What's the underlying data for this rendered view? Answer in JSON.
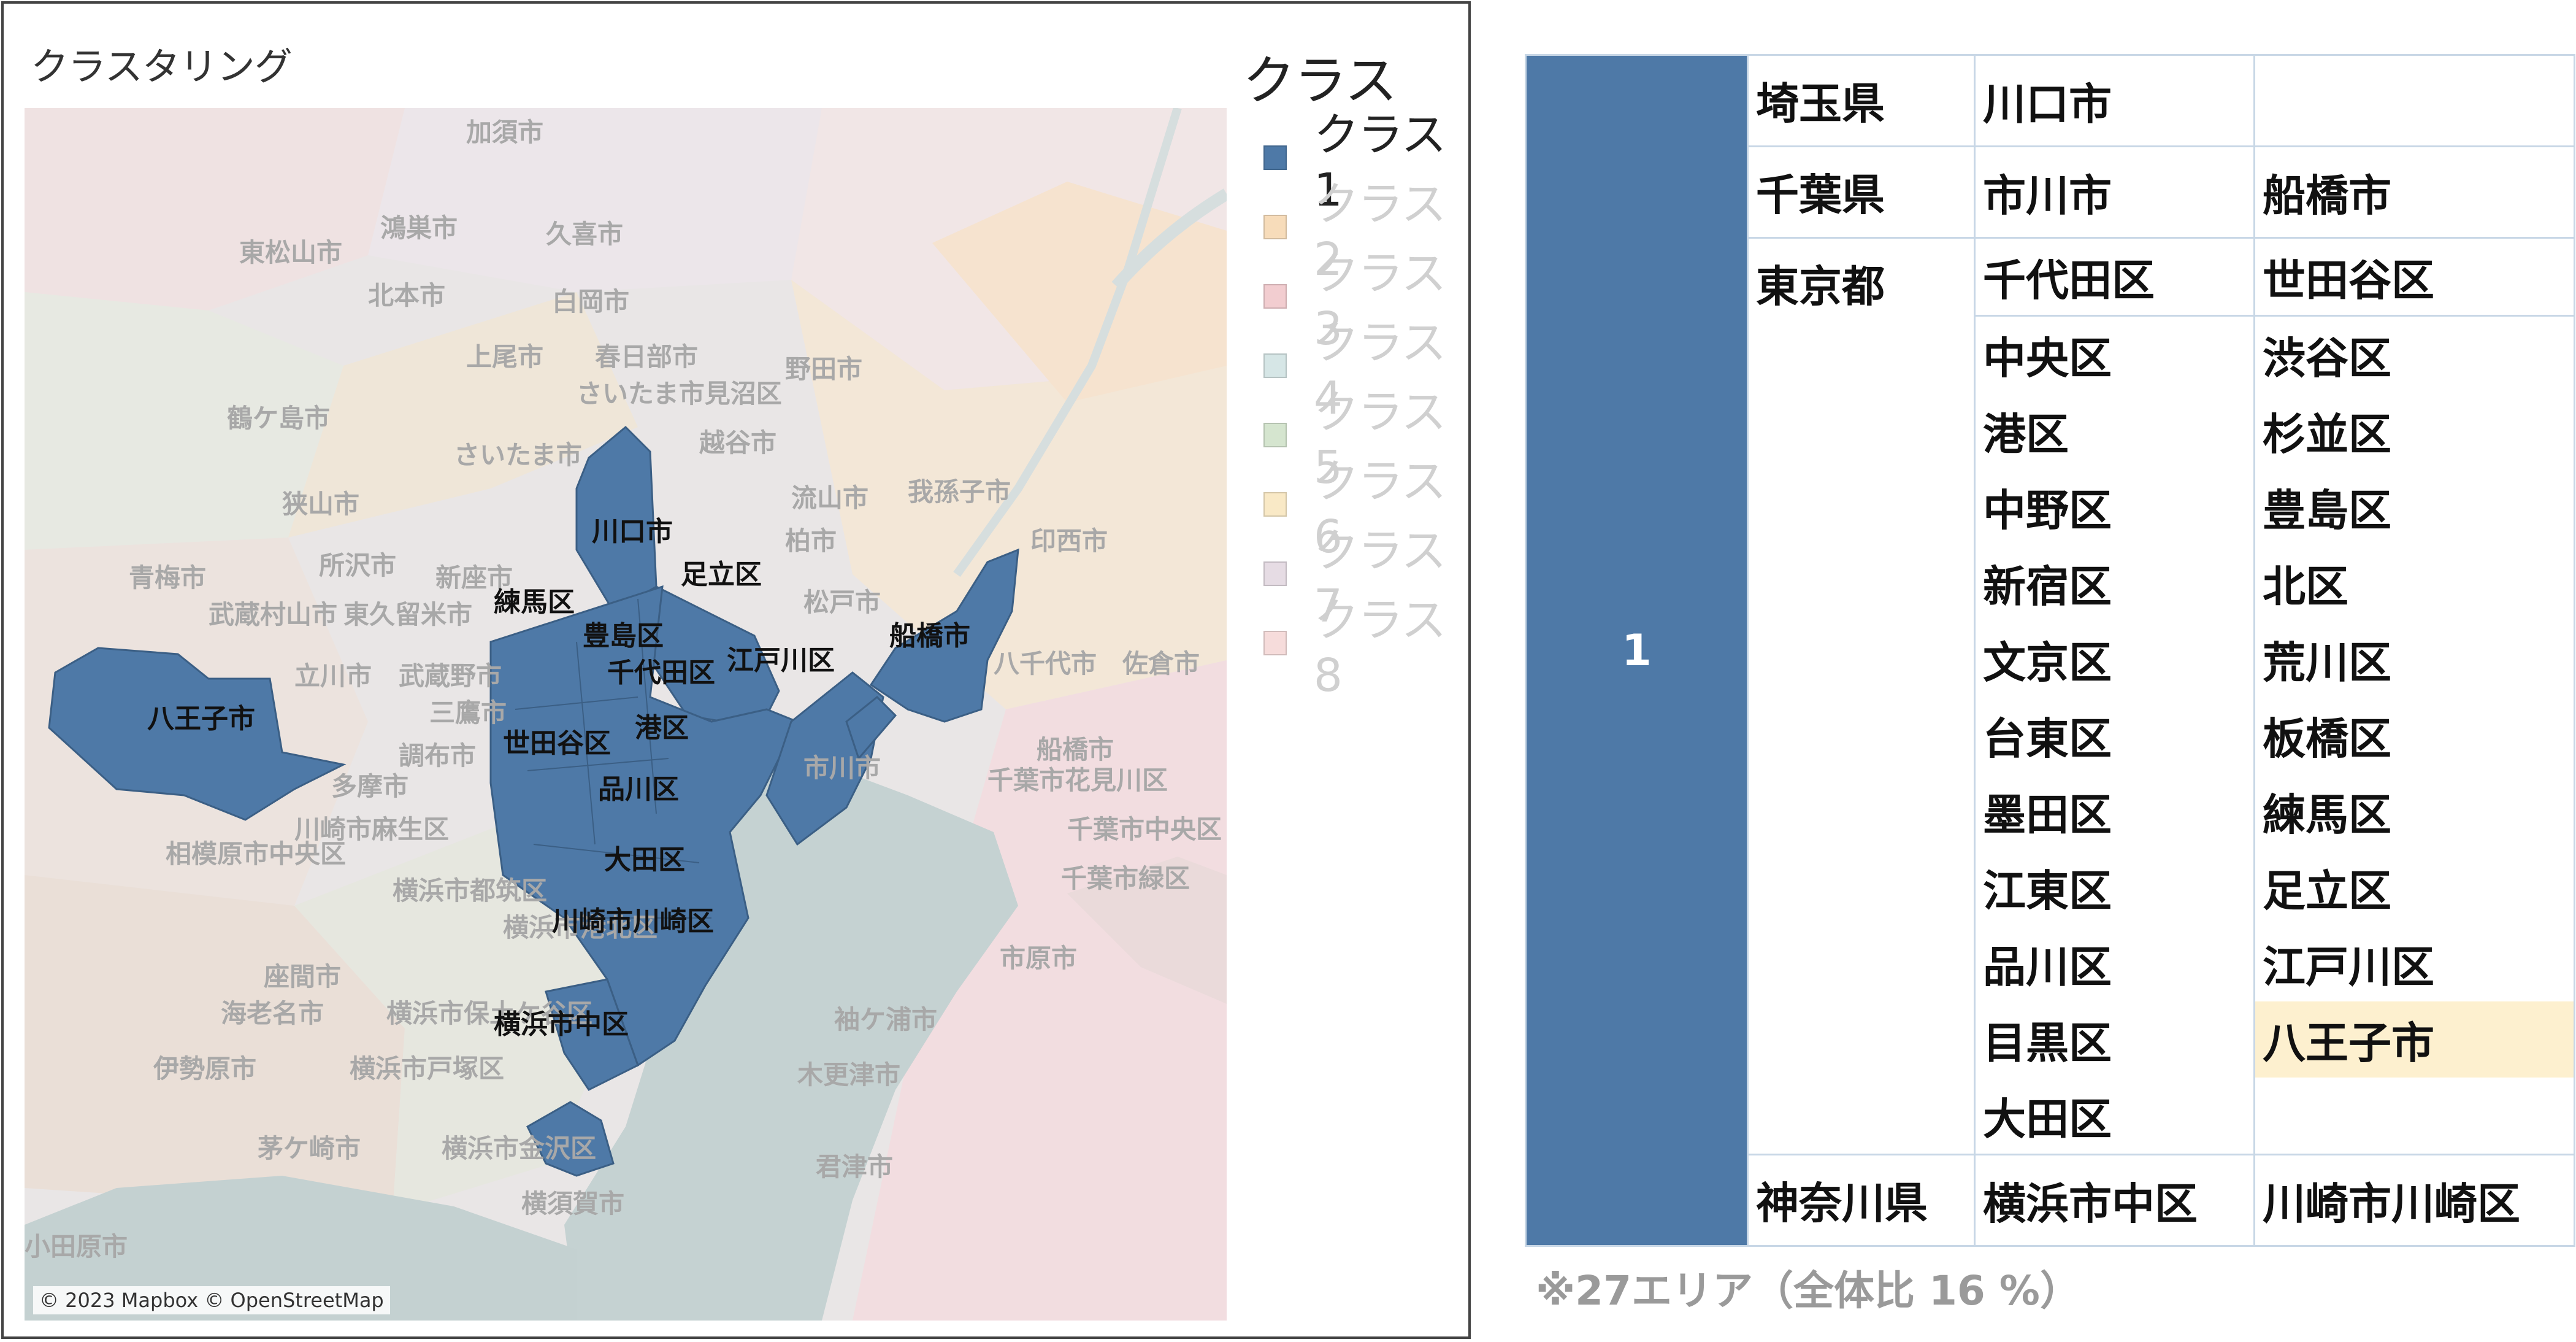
{
  "map_panel": {
    "title": "クラスタリング",
    "attribution": "© 2023 Mapbox © OpenStreetMap",
    "background_labels": [
      "加須市",
      "東松山市",
      "鴻巣市",
      "久喜市",
      "北本市",
      "白岡市",
      "上尾市",
      "春日部市",
      "鶴ケ島市",
      "野田市",
      "さいたま市",
      "さいたま市見沼区",
      "越谷市",
      "狭山市",
      "流山市",
      "我孫子市",
      "青梅市",
      "所沢市",
      "新座市",
      "柏市",
      "印西市",
      "武蔵村山市",
      "東久留米市",
      "松戸市",
      "八千代市",
      "佐倉市",
      "立川市",
      "武蔵野市",
      "三鷹市",
      "船橋市",
      "市川市",
      "調布市",
      "多摩市",
      "千葉市花見川区",
      "川崎市麻生区",
      "相模原市中央区",
      "千葉市中央区",
      "横浜市都筑区",
      "千葉市緑区",
      "横浜市港北区",
      "座間市",
      "市原市",
      "海老名市",
      "横浜市保土ケ谷区",
      "袖ケ浦市",
      "伊勢原市",
      "横浜市戸塚区",
      "木更津市",
      "茅ケ崎市",
      "横浜市金沢区",
      "君津市",
      "横須賀市",
      "小田原市"
    ],
    "class1_labels": [
      "川口市",
      "足立区",
      "練馬区",
      "豊島区",
      "千代田区",
      "江戸川区",
      "船橋市",
      "八王子市",
      "世田谷区",
      "港区",
      "品川区",
      "大田区",
      "川崎市川崎区",
      "横浜市中区"
    ]
  },
  "legend": {
    "title": "クラス",
    "items": [
      {
        "label": "クラス1",
        "color": "#4e79a7",
        "active": true
      },
      {
        "label": "クラス2",
        "color": "#f7dcba",
        "active": false
      },
      {
        "label": "クラス3",
        "color": "#f2cdd0",
        "active": false
      },
      {
        "label": "クラス4",
        "color": "#d6e6e6",
        "active": false
      },
      {
        "label": "クラス5",
        "color": "#d5e5cf",
        "active": false
      },
      {
        "label": "クラス6",
        "color": "#f9e9c6",
        "active": false
      },
      {
        "label": "クラス7",
        "color": "#e6dce4",
        "active": false
      },
      {
        "label": "クラス8",
        "color": "#f6dcdb",
        "active": false
      }
    ]
  },
  "table": {
    "class_number": "1",
    "saitama": {
      "pref": "埼玉県",
      "cities": [
        "川口市",
        ""
      ]
    },
    "chiba": {
      "pref": "千葉県",
      "cities": [
        "市川市",
        "船橋市"
      ]
    },
    "tokyo": {
      "pref": "東京都",
      "rows": [
        [
          "千代田区",
          "世田谷区"
        ],
        [
          "中央区",
          "渋谷区"
        ],
        [
          "港区",
          "杉並区"
        ],
        [
          "中野区",
          "豊島区"
        ],
        [
          "新宿区",
          "北区"
        ],
        [
          "文京区",
          "荒川区"
        ],
        [
          "台東区",
          "板橋区"
        ],
        [
          "墨田区",
          "練馬区"
        ],
        [
          "江東区",
          "足立区"
        ],
        [
          "品川区",
          "江戸川区"
        ],
        [
          "目黒区",
          "八王子市"
        ],
        [
          "大田区",
          ""
        ]
      ],
      "highlight": "八王子市"
    },
    "kanagawa": {
      "pref": "神奈川県",
      "cities": [
        "横浜市中区",
        "川崎市川崎区"
      ]
    },
    "footnote": "※27エリア（全体比 16 %）"
  }
}
